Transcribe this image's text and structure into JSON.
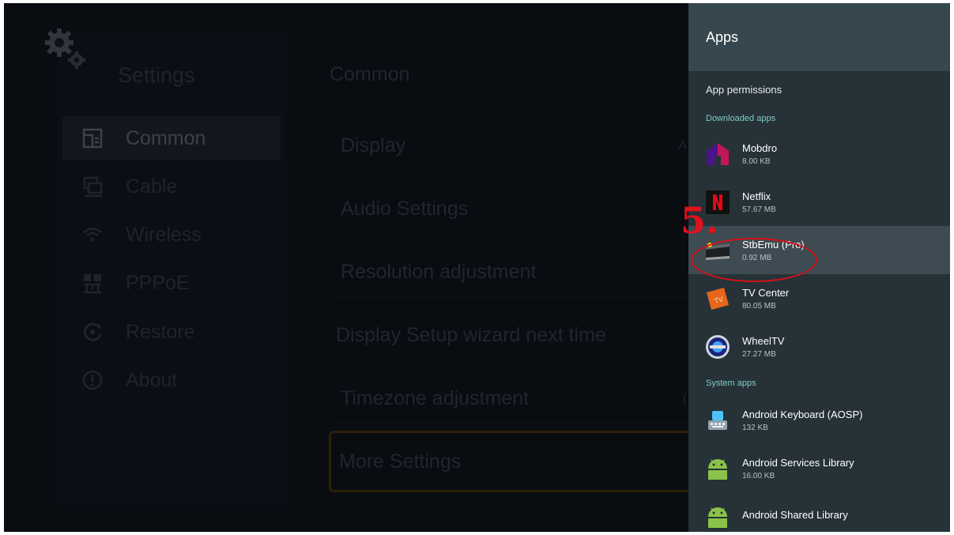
{
  "settings": {
    "title": "Settings",
    "nav": [
      {
        "label": "Common",
        "icon": "common-icon",
        "active": true
      },
      {
        "label": "Cable",
        "icon": "cable-icon"
      },
      {
        "label": "Wireless",
        "icon": "wifi-icon"
      },
      {
        "label": "PPPoE",
        "icon": "network-icon"
      },
      {
        "label": "Restore",
        "icon": "restore-icon"
      },
      {
        "label": "About",
        "icon": "info-icon"
      }
    ]
  },
  "common": {
    "title": "Common",
    "options": [
      {
        "label": "Display",
        "value": "A"
      },
      {
        "label": "Audio Settings"
      },
      {
        "label": "Resolution adjustment"
      },
      {
        "label": "Display Setup wizard next time"
      },
      {
        "label": "Timezone adjustment",
        "value": "("
      },
      {
        "label": "More Settings",
        "focused": true
      }
    ]
  },
  "apps_panel": {
    "title": "Apps",
    "permissions_label": "App permissions",
    "downloaded_label": "Downloaded apps",
    "system_label": "System apps",
    "downloaded": [
      {
        "name": "Mobdro",
        "size": "8.00 KB",
        "icon": "mobdro-icon"
      },
      {
        "name": "Netflix",
        "size": "57.67 MB",
        "icon": "netflix-icon"
      },
      {
        "name": "StbEmu (Pro)",
        "size": "0.92 MB",
        "icon": "stbemu-icon",
        "selected": true
      },
      {
        "name": "TV Center",
        "size": "80.05 MB",
        "icon": "tv-center-icon"
      },
      {
        "name": "WheelTV",
        "size": "27.27 MB",
        "icon": "wheeltv-icon"
      }
    ],
    "system": [
      {
        "name": "Android Keyboard (AOSP)",
        "size": "132 KB",
        "icon": "keyboard-icon"
      },
      {
        "name": "Android Services Library",
        "size": "16.00 KB",
        "icon": "android-icon"
      },
      {
        "name": "Android Shared Library",
        "size": "",
        "icon": "android-icon"
      }
    ]
  },
  "annotation": {
    "step": "5."
  },
  "colors": {
    "drawer_bg": "#263238",
    "drawer_header": "#37474f",
    "section_text": "#80cbc4",
    "annotation": "#e0121b",
    "focus_border": "#4f3d0c"
  }
}
